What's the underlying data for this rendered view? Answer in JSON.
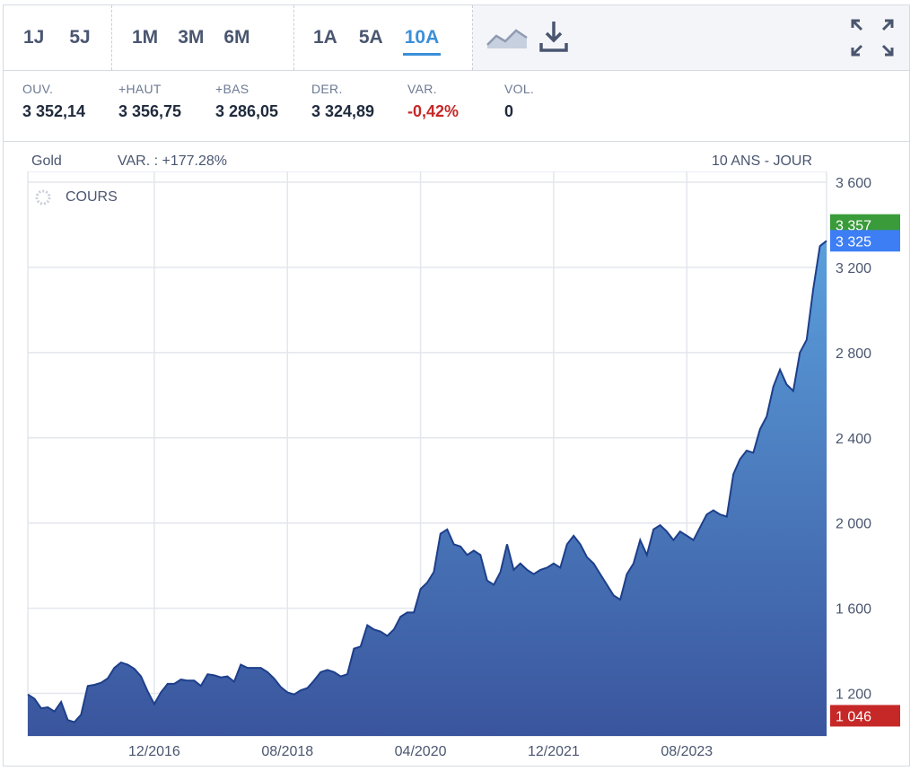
{
  "toolbar": {
    "periods_a": [
      "1J",
      "5J"
    ],
    "periods_b": [
      "1M",
      "3M",
      "6M"
    ],
    "periods_c": [
      "1A",
      "5A",
      "10A"
    ],
    "active_period": "10A",
    "icons": [
      "area-chart-icon",
      "download-icon",
      "fullscreen-icon"
    ]
  },
  "stats": [
    {
      "label": "OUV.",
      "value": "3 352,14"
    },
    {
      "label": "+HAUT",
      "value": "3 356,75"
    },
    {
      "label": "+BAS",
      "value": "3 286,05"
    },
    {
      "label": "DER.",
      "value": "3 324,89"
    },
    {
      "label": "VAR.",
      "value": "-0,42%"
    },
    {
      "label": "VOL.",
      "value": "0"
    }
  ],
  "chart_header": {
    "instrument": "Gold",
    "variation": "VAR. : +177.28%",
    "range_label": "10 ANS - JOUR",
    "series_label": "COURS"
  },
  "colors": {
    "negative": "#c62828",
    "accent": "#3b8fd9",
    "line": "#1d3f8a",
    "fill_top": "#5b9fdc",
    "fill_bottom": "#3a559d",
    "last_marker": "#3d7ef5",
    "high_marker": "#3a9b3a",
    "low_marker": "#c62828"
  },
  "chart_data": {
    "type": "area",
    "series_name": "COURS",
    "ylim": [
      1000,
      3600
    ],
    "y_ticks": [
      1200,
      1600,
      2000,
      2400,
      2800,
      3200,
      3600
    ],
    "y_tick_labels": [
      "1 200",
      "1 600",
      "2 000",
      "2 400",
      "2 800",
      "3 200",
      "3 600"
    ],
    "x_ticks": [
      "2016-12",
      "2018-08",
      "2020-04",
      "2021-12",
      "2023-08"
    ],
    "x_tick_labels": [
      "12/2016",
      "08/2018",
      "04/2020",
      "12/2021",
      "08/2023"
    ],
    "markers": {
      "last": "3 325",
      "low": "1 046",
      "high": "3 357"
    },
    "x": [
      "2015-05",
      "2015-06",
      "2015-07",
      "2015-08",
      "2015-09",
      "2015-10",
      "2015-11",
      "2015-12",
      "2016-01",
      "2016-02",
      "2016-03",
      "2016-04",
      "2016-05",
      "2016-06",
      "2016-07",
      "2016-08",
      "2016-09",
      "2016-10",
      "2016-11",
      "2016-12",
      "2017-01",
      "2017-02",
      "2017-03",
      "2017-04",
      "2017-05",
      "2017-06",
      "2017-07",
      "2017-08",
      "2017-09",
      "2017-10",
      "2017-11",
      "2017-12",
      "2018-01",
      "2018-02",
      "2018-03",
      "2018-04",
      "2018-05",
      "2018-06",
      "2018-07",
      "2018-08",
      "2018-09",
      "2018-10",
      "2018-11",
      "2018-12",
      "2019-01",
      "2019-02",
      "2019-03",
      "2019-04",
      "2019-05",
      "2019-06",
      "2019-07",
      "2019-08",
      "2019-09",
      "2019-10",
      "2019-11",
      "2019-12",
      "2020-01",
      "2020-02",
      "2020-03",
      "2020-04",
      "2020-05",
      "2020-06",
      "2020-07",
      "2020-08",
      "2020-09",
      "2020-10",
      "2020-11",
      "2020-12",
      "2021-01",
      "2021-02",
      "2021-03",
      "2021-04",
      "2021-05",
      "2021-06",
      "2021-07",
      "2021-08",
      "2021-09",
      "2021-10",
      "2021-11",
      "2021-12",
      "2022-01",
      "2022-02",
      "2022-03",
      "2022-04",
      "2022-05",
      "2022-06",
      "2022-07",
      "2022-08",
      "2022-09",
      "2022-10",
      "2022-11",
      "2022-12",
      "2023-01",
      "2023-02",
      "2023-03",
      "2023-04",
      "2023-05",
      "2023-06",
      "2023-07",
      "2023-08",
      "2023-09",
      "2023-10",
      "2023-11",
      "2023-12",
      "2024-01",
      "2024-02",
      "2024-03",
      "2024-04",
      "2024-05",
      "2024-06",
      "2024-07",
      "2024-08",
      "2024-09",
      "2024-10",
      "2024-11",
      "2024-12",
      "2025-01",
      "2025-02",
      "2025-03",
      "2025-04",
      "2025-05"
    ],
    "values": [
      1195,
      1175,
      1130,
      1135,
      1115,
      1160,
      1075,
      1065,
      1100,
      1235,
      1240,
      1250,
      1270,
      1320,
      1345,
      1335,
      1315,
      1280,
      1210,
      1150,
      1205,
      1245,
      1245,
      1265,
      1260,
      1260,
      1235,
      1290,
      1285,
      1275,
      1280,
      1255,
      1335,
      1320,
      1320,
      1320,
      1300,
      1270,
      1230,
      1205,
      1195,
      1215,
      1225,
      1260,
      1300,
      1310,
      1300,
      1280,
      1290,
      1410,
      1420,
      1520,
      1500,
      1490,
      1470,
      1500,
      1560,
      1580,
      1580,
      1690,
      1720,
      1770,
      1950,
      1970,
      1900,
      1890,
      1850,
      1870,
      1850,
      1730,
      1710,
      1770,
      1900,
      1780,
      1810,
      1780,
      1760,
      1780,
      1790,
      1810,
      1790,
      1900,
      1940,
      1900,
      1840,
      1810,
      1760,
      1710,
      1660,
      1640,
      1760,
      1810,
      1920,
      1850,
      1970,
      1990,
      1960,
      1920,
      1960,
      1940,
      1920,
      1980,
      2040,
      2060,
      2040,
      2030,
      2230,
      2300,
      2340,
      2330,
      2440,
      2500,
      2640,
      2720,
      2650,
      2620,
      2800,
      2860,
      3100,
      3300,
      3325
    ]
  }
}
